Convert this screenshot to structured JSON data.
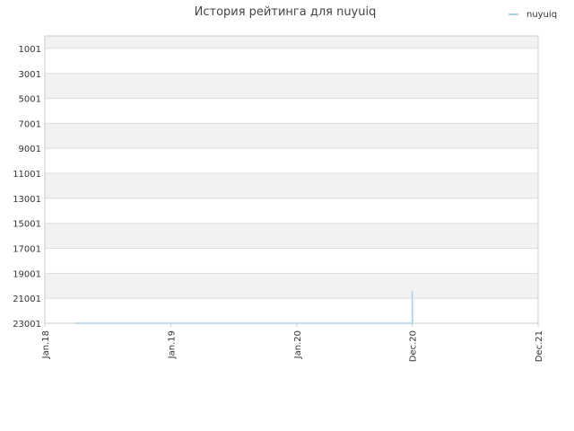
{
  "chart_data": {
    "type": "line",
    "title": "История рейтинга для nuyuiq",
    "xlabel": "",
    "ylabel": "",
    "y_reversed": true,
    "ylim": [
      23001,
      0
    ],
    "y_ticks": [
      1001,
      3001,
      5001,
      7001,
      9001,
      11001,
      13001,
      15001,
      17001,
      19001,
      21001,
      23001
    ],
    "x_range": [
      "2018-01-01",
      "2021-12-01"
    ],
    "x_ticks": [
      {
        "date": "2018-01-01",
        "label": "Jan.18"
      },
      {
        "date": "2019-01-01",
        "label": "Jan.19"
      },
      {
        "date": "2020-01-01",
        "label": "Jan.20"
      },
      {
        "date": "2020-12-01",
        "label": "Dec.20"
      },
      {
        "date": "2021-12-01",
        "label": "Dec.21"
      }
    ],
    "grid": true,
    "legend_position": "top-right",
    "colors": {
      "series": "#a9d2ec",
      "band": "#f2f2f2",
      "grid": "#dddddd",
      "axis": "#cccccc"
    },
    "series": [
      {
        "name": "nuyuiq",
        "points": [
          {
            "date": "2018-04-01",
            "value": 23001
          },
          {
            "date": "2020-12-01",
            "value": 23001
          },
          {
            "date": "2020-12-01",
            "value": 20401
          },
          {
            "date": "2020-12-02",
            "value": 23001
          }
        ]
      }
    ]
  }
}
